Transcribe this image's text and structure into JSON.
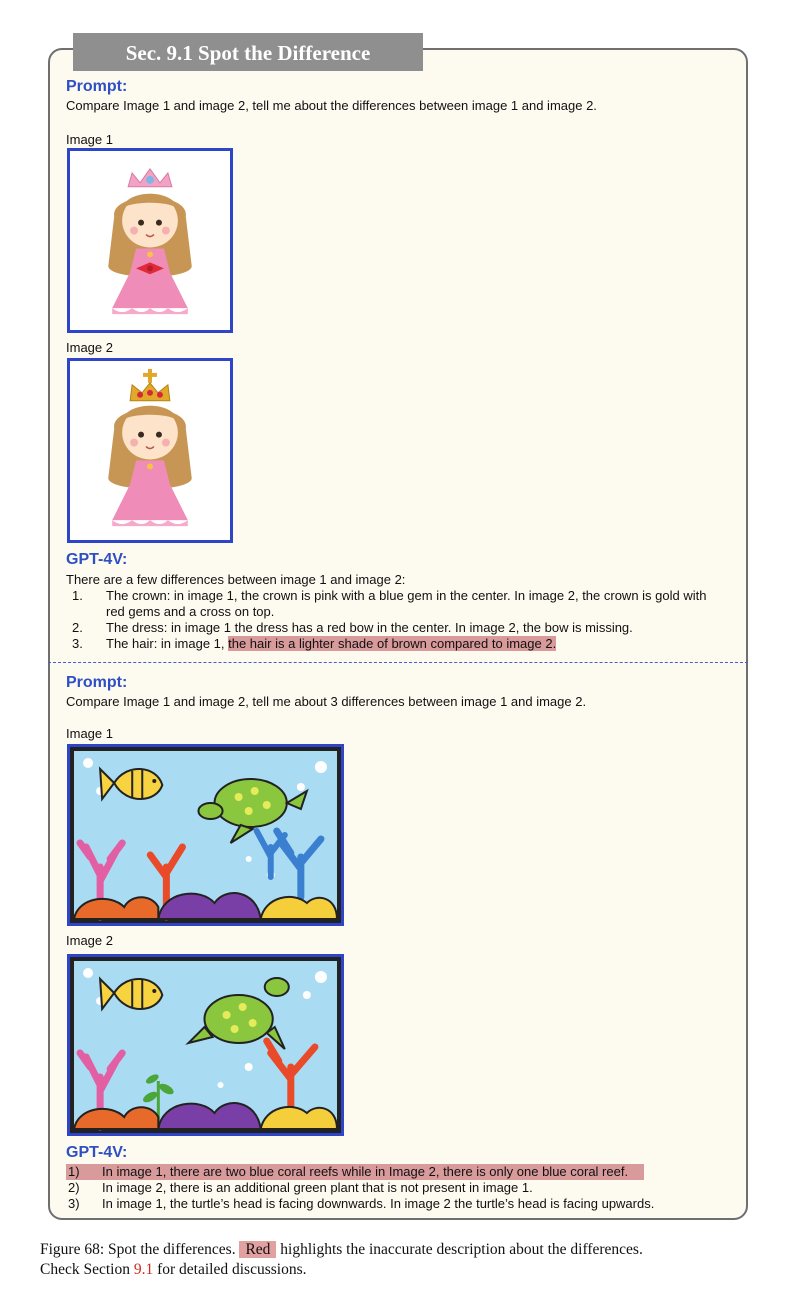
{
  "section_title": "Sec. 9.1 Spot the Difference",
  "example1": {
    "prompt_label": "Prompt:",
    "prompt_text": "Compare Image 1 and image 2, tell me about the differences between image 1 and image 2.",
    "image1_caption": "Image 1",
    "image2_caption": "Image 2",
    "response_label": "GPT-4V:",
    "response_intro": "There are a few differences between image 1 and image 2:",
    "items": [
      {
        "num": "1.",
        "line1": "The crown: in image 1, the crown is pink with a blue gem in the center. In image 2, the crown is gold with",
        "line2": "red gems and a cross on top."
      },
      {
        "num": "2.",
        "line1": "The dress: in image 1 the dress has a red bow in the center. In image 2, the bow is missing."
      },
      {
        "num": "3.",
        "plain": "The hair: in image 1, ",
        "highlight": "the hair is a lighter shade of brown compared to image 2."
      }
    ]
  },
  "example2": {
    "prompt_label": "Prompt:",
    "prompt_text": "Compare Image 1 and image 2, tell me about 3 differences between image 1 and image 2.",
    "image1_caption": "Image 1",
    "image2_caption": "Image 2",
    "response_label": "GPT-4V:",
    "items": [
      {
        "num": "1)",
        "text": "In image 1, there are two blue coral reefs while in Image 2, there is only one blue coral reef.",
        "highlighted": true
      },
      {
        "num": "2)",
        "text": "In image 2, there is an additional green plant that is not present in image 1."
      },
      {
        "num": "3)",
        "text": "In image 1, the turtle’s head is facing downwards. In image 2 the turtle’s head is facing upwards."
      }
    ]
  },
  "caption": {
    "prefix": "Figure 68: Spot the differences. ",
    "red_tag": "Red",
    "middle": " highlights the inaccurate description about the differences.",
    "line2_a": "Check Section ",
    "ref": "9.1",
    "line2_b": " for detailed discussions."
  },
  "colors": {
    "header_blue": "#2f4fc4",
    "highlight": "#d89a9a",
    "panel_bg": "#fdfaf0",
    "frame_blue": "#2f45c9"
  }
}
